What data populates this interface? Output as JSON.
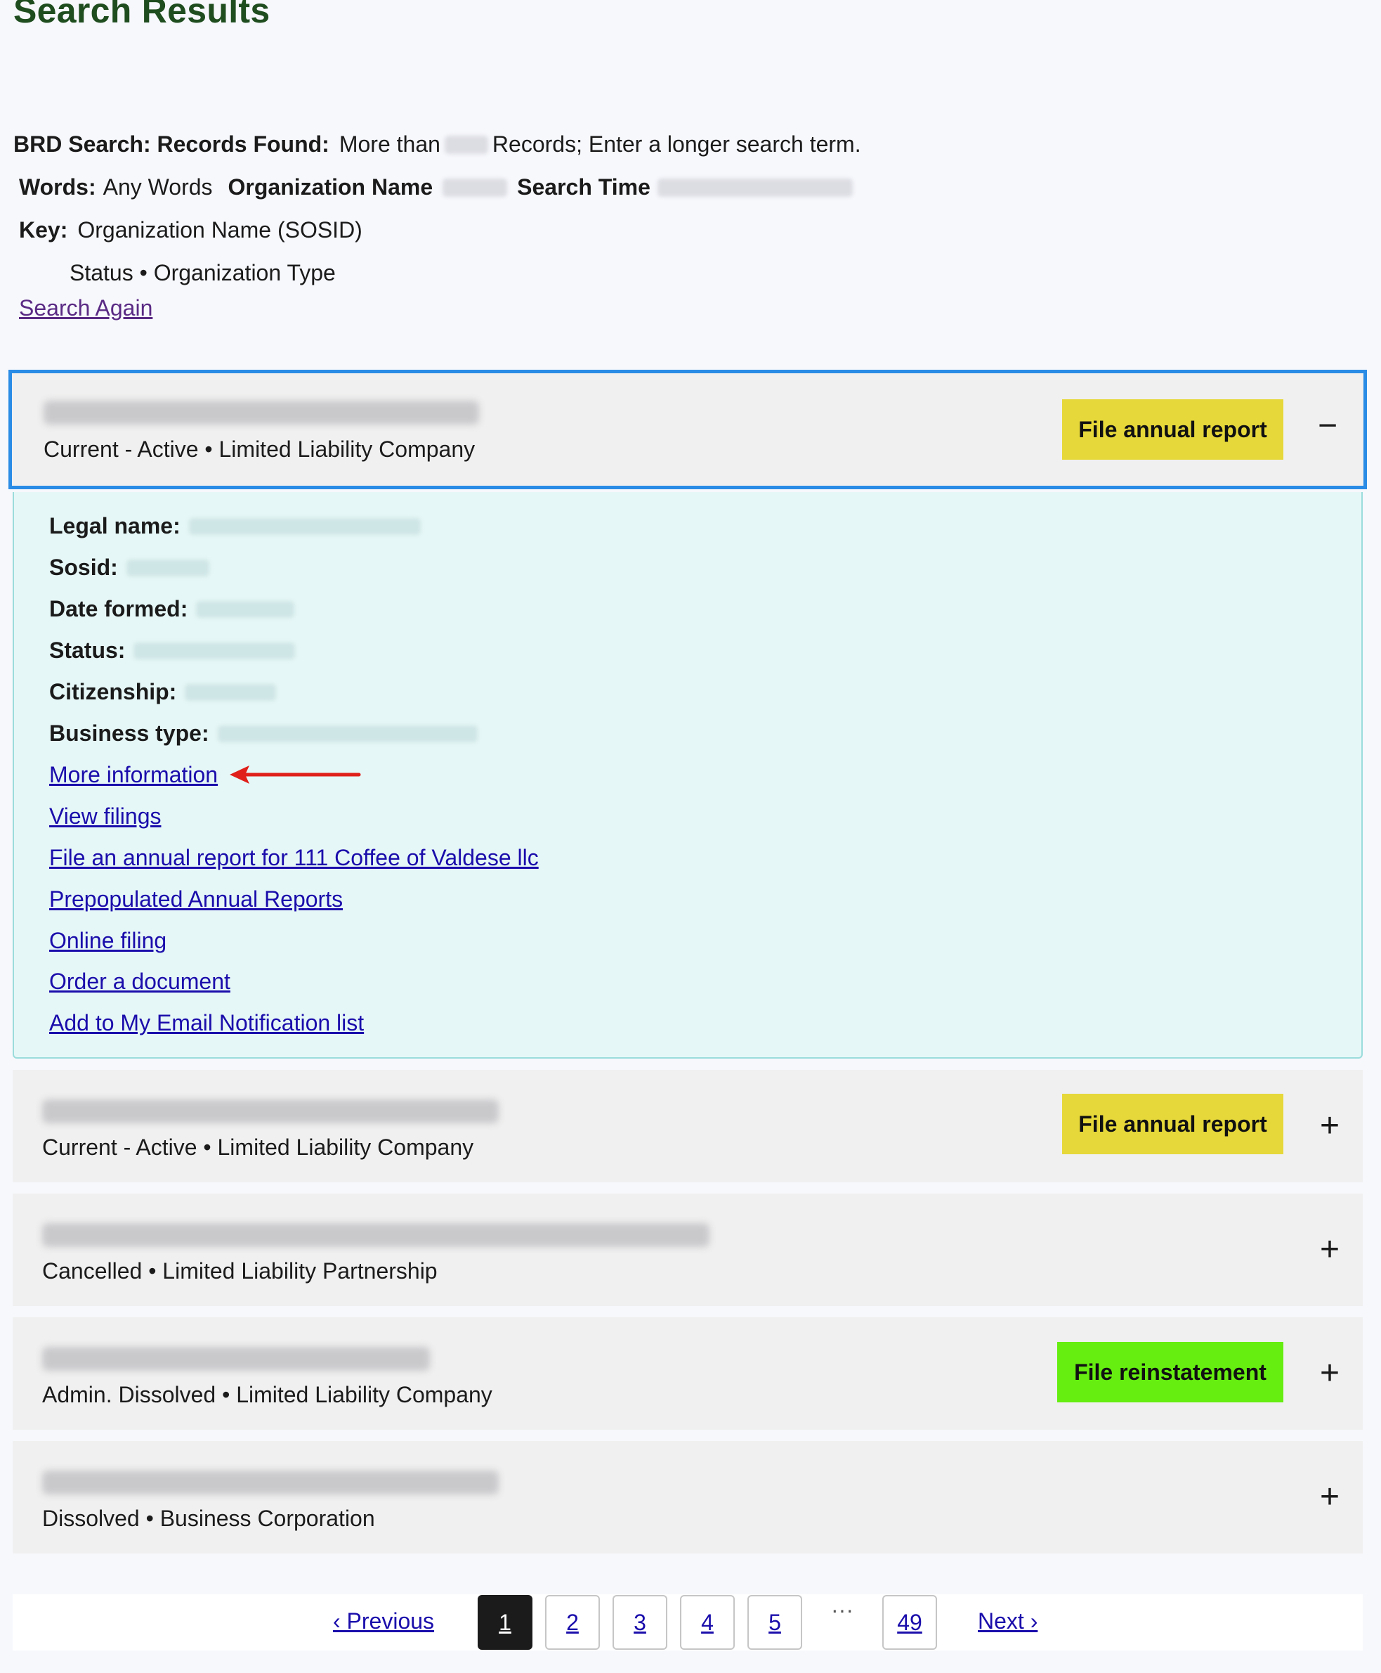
{
  "page_title": "Search Results",
  "summary": {
    "brd_label": "BRD Search: Records Found:",
    "more_than": "More than",
    "records_suffix": "Records; Enter a longer search term.",
    "words_label": "Words:",
    "words_value": "Any Words",
    "org_name_label": "Organization Name",
    "search_time_label": "Search Time",
    "key_label": "Key:",
    "key_value": "Organization Name (SOSID)",
    "key_line2": "Status • Organization Type",
    "search_again": "Search Again"
  },
  "results": [
    {
      "meta": "Current - Active  •  Limited Liability Company",
      "button": "File annual report",
      "toggle": "−"
    },
    {
      "meta": "Current - Active  •  Limited Liability Company",
      "button": "File annual report",
      "toggle": "+"
    },
    {
      "meta": "Cancelled  •  Limited Liability Partnership",
      "toggle": "+"
    },
    {
      "meta": "Admin. Dissolved  •  Limited Liability Company",
      "button": "File reinstatement",
      "toggle": "+"
    },
    {
      "meta": "Dissolved  •  Business Corporation",
      "toggle": "+"
    }
  ],
  "details": {
    "legal_name_label": "Legal name:",
    "sosid_label": "Sosid:",
    "date_formed_label": "Date formed:",
    "status_label": "Status:",
    "citizenship_label": "Citizenship:",
    "business_type_label": "Business type:",
    "links": [
      "More information",
      "View filings",
      "File an annual report for 111 Coffee of Valdese llc",
      "Prepopulated Annual Reports",
      "Online filing",
      "Order a document",
      "Add to My Email Notification list"
    ]
  },
  "pagination": {
    "previous": "‹ Previous",
    "pages": [
      "1",
      "2",
      "3",
      "4",
      "5"
    ],
    "ellipsis": "···",
    "last_page": "49",
    "next": "Next ›"
  },
  "colors": {
    "title_green": "#1f4d1f",
    "focus_border": "#2b8ce6",
    "annual_button": "#e6d83a",
    "reinstate_button": "#66ee10",
    "details_bg": "#e6f7f7",
    "link": "#1a0dab",
    "visited_link": "#5a2a84",
    "annotation_arrow": "#e0201a"
  }
}
